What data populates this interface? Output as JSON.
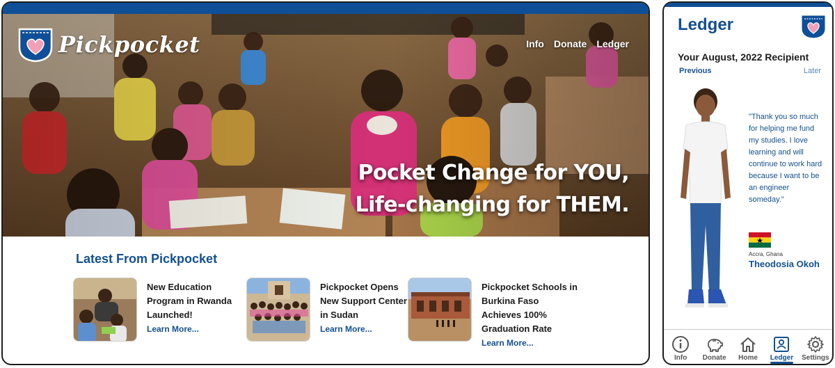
{
  "desktop": {
    "brand": "Pickpocket",
    "nav": [
      "Info",
      "Donate",
      "Ledger"
    ],
    "headline": [
      "Pocket Change for YOU,",
      "Life-changing for THEM."
    ],
    "latest_title": "Latest From Pickpocket",
    "articles": [
      {
        "title": "New Education Program in Rwanda Launched!",
        "link": "Learn More..."
      },
      {
        "title": "Pickpocket Opens New Support Center in Sudan",
        "link": "Learn More..."
      },
      {
        "title": "Pickpocket Schools in Burkina Faso Achieves 100% Graduation Rate",
        "link": "Learn More..."
      }
    ]
  },
  "mobile": {
    "title": "Ledger",
    "subtitle": "Your August, 2022 Recipient",
    "prev": "Previous",
    "later": "Later",
    "quote": "\"Thank you so much for helping me fund my studies. I love learning and will continue to work hard because I want to be an engineer someday.\"",
    "location": "Accra, Ghana",
    "recipient": "Theodosia Okoh",
    "tabs": [
      {
        "label": "Info",
        "icon": "info-icon"
      },
      {
        "label": "Donate",
        "icon": "piggy-bank-icon"
      },
      {
        "label": "Home",
        "icon": "home-icon"
      },
      {
        "label": "Ledger",
        "icon": "ledger-icon",
        "active": true
      },
      {
        "label": "Settings",
        "icon": "gear-icon"
      }
    ]
  },
  "colors": {
    "brand_blue": "#0e4f97",
    "link_blue": "#14508f",
    "badge_heart": "#f2a0b8"
  }
}
